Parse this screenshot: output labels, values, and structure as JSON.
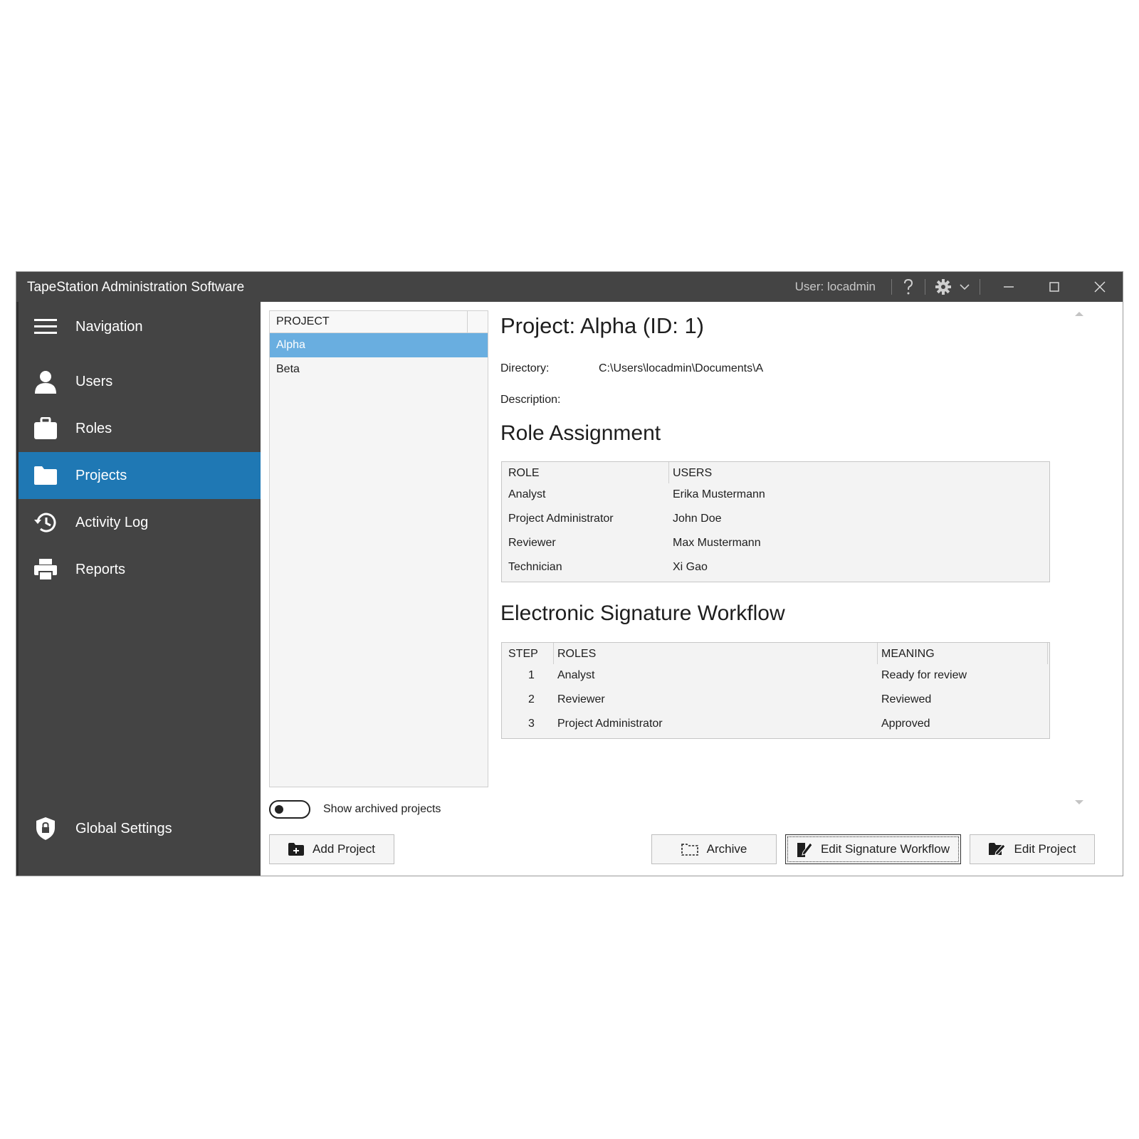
{
  "window": {
    "title": "TapeStation Administration Software",
    "user_label": "User: locadmin"
  },
  "sidebar": {
    "items": [
      {
        "label": "Navigation",
        "icon": "hamburger-icon"
      },
      {
        "label": "Users",
        "icon": "user-icon"
      },
      {
        "label": "Roles",
        "icon": "briefcase-icon"
      },
      {
        "label": "Projects",
        "icon": "folder-icon",
        "active": true
      },
      {
        "label": "Activity Log",
        "icon": "history-icon"
      },
      {
        "label": "Reports",
        "icon": "printer-icon"
      }
    ],
    "footer": {
      "label": "Global Settings",
      "icon": "shield-lock-icon"
    }
  },
  "project_list": {
    "header": "PROJECT",
    "items": [
      "Alpha",
      "Beta"
    ],
    "selected": "Alpha"
  },
  "archived_toggle": {
    "label": "Show archived projects",
    "on": false
  },
  "detail": {
    "title": "Project: Alpha (ID: 1)",
    "directory_label": "Directory:",
    "directory_value": "C:\\Users\\locadmin\\Documents\\A",
    "description_label": "Description:",
    "description_value": ""
  },
  "role_assignment": {
    "title": "Role Assignment",
    "columns": [
      "ROLE",
      "USERS"
    ],
    "rows": [
      [
        "Analyst",
        "Erika Mustermann"
      ],
      [
        "Project Administrator",
        "John Doe"
      ],
      [
        "Reviewer",
        "Max Mustermann"
      ],
      [
        "Technician",
        "Xi Gao"
      ]
    ]
  },
  "signature_workflow": {
    "title": "Electronic Signature Workflow",
    "columns": [
      "STEP",
      "ROLES",
      "MEANING"
    ],
    "rows": [
      [
        "1",
        "Analyst",
        "Ready for review"
      ],
      [
        "2",
        "Reviewer",
        "Reviewed"
      ],
      [
        "3",
        "Project Administrator",
        "Approved"
      ]
    ]
  },
  "buttons": {
    "add_project": "Add Project",
    "archive": "Archive",
    "edit_signature_workflow": "Edit Signature Workflow",
    "edit_project": "Edit Project"
  },
  "colors": {
    "titlebar": "#444444",
    "sidebar": "#444444",
    "nav_active": "#1f78b4",
    "list_selected": "#69aee0"
  }
}
